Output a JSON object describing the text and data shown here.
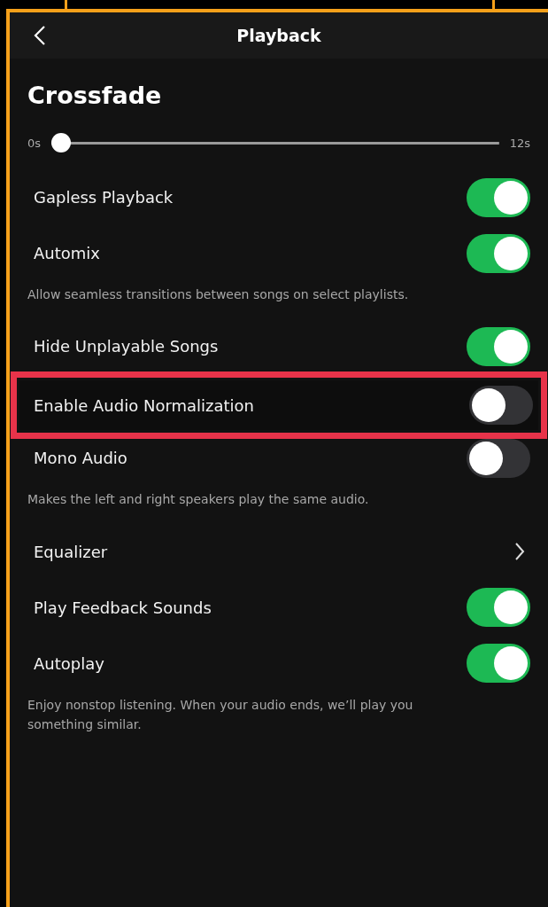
{
  "header": {
    "title": "Playback"
  },
  "section": {
    "title": "Crossfade"
  },
  "slider": {
    "min_label": "0s",
    "max_label": "12s",
    "level": 0
  },
  "rows": [
    {
      "kind": "toggle",
      "label": "Gapless Playback",
      "on": true,
      "highlighted": false
    },
    {
      "kind": "toggle",
      "label": "Automix",
      "on": true,
      "highlighted": false
    },
    {
      "kind": "note",
      "text": "Allow seamless transitions between songs on select playlists."
    },
    {
      "kind": "toggle",
      "label": "Hide Unplayable Songs",
      "on": true,
      "highlighted": false
    },
    {
      "kind": "toggle",
      "label": "Enable Audio Normalization",
      "on": false,
      "highlighted": true
    },
    {
      "kind": "toggle",
      "label": "Mono Audio",
      "on": false,
      "highlighted": false
    },
    {
      "kind": "note",
      "text": "Makes the left and right speakers play the same audio."
    },
    {
      "kind": "link",
      "label": "Equalizer",
      "highlighted": false
    },
    {
      "kind": "toggle",
      "label": "Play Feedback Sounds",
      "on": true,
      "highlighted": false
    },
    {
      "kind": "toggle",
      "label": "Autoplay",
      "on": true,
      "highlighted": false
    },
    {
      "kind": "note",
      "text": "Enjoy nonstop listening. When your audio ends, we’ll play you something similar."
    }
  ]
}
